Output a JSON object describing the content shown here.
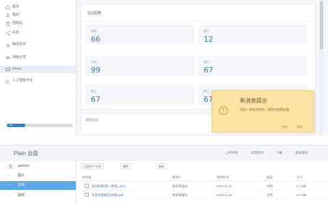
{
  "sidebar": {
    "items": [
      {
        "label": "首页",
        "icon": "home-icon"
      },
      {
        "label": "我的",
        "icon": "user-icon"
      },
      {
        "label": "回收站",
        "icon": "trash-icon"
      },
      {
        "label": "共享",
        "icon": "share-icon"
      },
      {
        "label": "离线任务",
        "icon": "download-icon"
      },
      {
        "label": "网络分享",
        "icon": "link-icon"
      },
      {
        "label": "Demo",
        "icon": "folder-icon"
      },
      {
        "label": "人工智能平台",
        "icon": "chart-icon"
      }
    ],
    "storage_percent": 28,
    "storage_label": "28%"
  },
  "dashboard": {
    "title": "5G品牌",
    "stats": [
      {
        "label": "视频",
        "value": "66"
      },
      {
        "label": "图片",
        "value": "12"
      },
      {
        "label": "文档",
        "value": "99"
      },
      {
        "label": "音乐",
        "value": "67"
      },
      {
        "label": "其它",
        "value": "67"
      },
      {
        "label": "种子",
        "value": "676"
      }
    ],
    "sub_card_title": "最新动态"
  },
  "toast": {
    "title": "新消息提示",
    "message": "您有一条新的待办，请及时查看处理",
    "cancel_label": "取消",
    "confirm_label": "确定",
    "accent": "#fbe3a6",
    "icon": "warning-icon"
  },
  "file_app": {
    "title": "Plain 云盘",
    "top_actions": [
      "上传文件",
      "新建文件",
      "下载",
      "更多操作"
    ],
    "user": "gaberm",
    "tree": [
      {
        "label": "图片",
        "active": false
      },
      {
        "label": "文档",
        "active": true
      },
      {
        "label": "视频",
        "active": false
      }
    ],
    "toolbar": [
      "已选中1个文件",
      "删除",
      "移动"
    ],
    "columns": [
      "文件名",
      "修改人",
      "修改时间",
      "类型",
      "大小"
    ],
    "rows": [
      {
        "name": "会议纪要(第一季度).docx",
        "owner": "系统管理员",
        "date": "2019-11-26",
        "type": "文档",
        "size": "2.1 MB"
      },
      {
        "name": "年度总结报告(终版).pdf",
        "owner": "系统管理员",
        "date": "2019-11-26",
        "type": "文档",
        "size": "3.4 MB"
      }
    ],
    "accent": "#5fa8e8"
  }
}
